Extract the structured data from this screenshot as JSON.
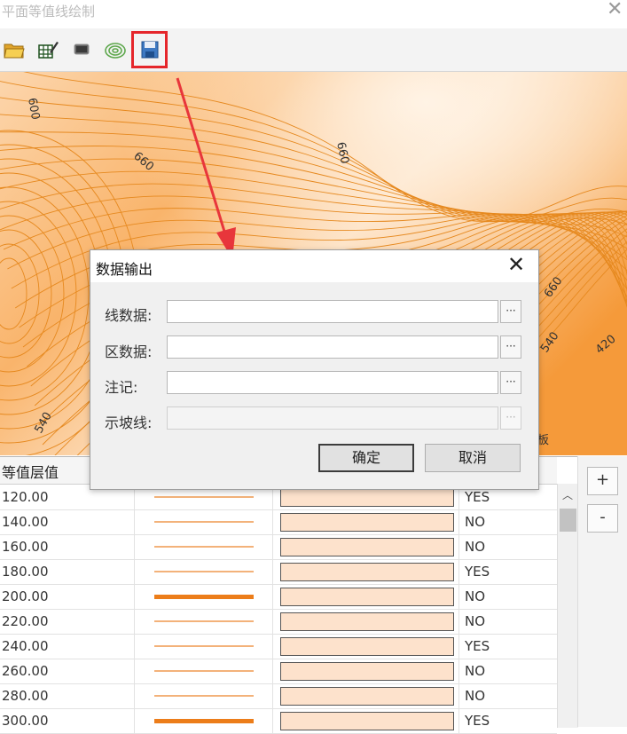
{
  "window": {
    "title": "平面等值线绘制",
    "close_glyph": "✕"
  },
  "toolbar": {
    "buttons": [
      {
        "name": "open-folder-icon"
      },
      {
        "name": "grid-edit-icon"
      },
      {
        "name": "monitor-icon"
      },
      {
        "name": "contour-icon"
      },
      {
        "name": "save-icon",
        "highlighted": true
      }
    ]
  },
  "map": {
    "labels": [
      "600",
      "660",
      "660",
      "660",
      "540",
      "420",
      "540",
      "板"
    ],
    "colors": {
      "light": "#fde7cf",
      "mid": "#f8b46a",
      "dark": "#f39430",
      "line": "#e6891f"
    }
  },
  "table": {
    "header": {
      "col1": "等值层值"
    },
    "rows": [
      {
        "value": "120.00",
        "flag": "YES",
        "thick": false
      },
      {
        "value": "140.00",
        "flag": "NO",
        "thick": false
      },
      {
        "value": "160.00",
        "flag": "NO",
        "thick": false
      },
      {
        "value": "180.00",
        "flag": "YES",
        "thick": false
      },
      {
        "value": "200.00",
        "flag": "NO",
        "thick": true
      },
      {
        "value": "220.00",
        "flag": "NO",
        "thick": false
      },
      {
        "value": "240.00",
        "flag": "YES",
        "thick": false
      },
      {
        "value": "260.00",
        "flag": "NO",
        "thick": false
      },
      {
        "value": "280.00",
        "flag": "NO",
        "thick": false
      },
      {
        "value": "300.00",
        "flag": "YES",
        "thick": true
      }
    ],
    "line_color": "#f3b27a",
    "thick_color": "#ec7d1a",
    "swatch_color": "#fde2cc"
  },
  "side": {
    "add_label": "+",
    "remove_label": "-"
  },
  "dialog": {
    "title": "数据输出",
    "close_glyph": "✕",
    "fields": [
      {
        "label": "线数据:",
        "value": "",
        "disabled": false
      },
      {
        "label": "区数据:",
        "value": "",
        "disabled": false
      },
      {
        "label": "注记:",
        "value": "",
        "disabled": false
      },
      {
        "label": "示坡线:",
        "value": "",
        "disabled": true
      }
    ],
    "browse_label": "···",
    "ok_label": "确定",
    "cancel_label": "取消"
  }
}
